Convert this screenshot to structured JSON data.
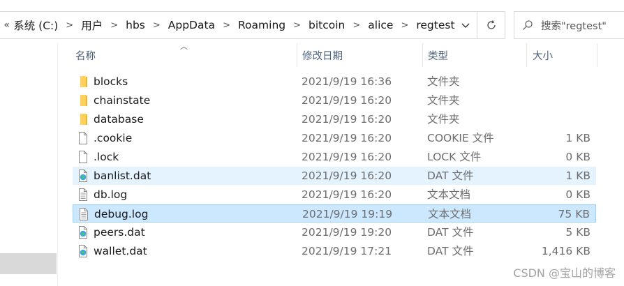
{
  "breadcrumb": {
    "overflow": "«",
    "items": [
      "系统 (C:)",
      "用户",
      "hbs",
      "AppData",
      "Roaming",
      "bitcoin",
      "alice",
      "regtest"
    ]
  },
  "search": {
    "placeholder": "搜索\"regtest\""
  },
  "columns": {
    "name": "名称",
    "date": "修改日期",
    "type": "类型",
    "size": "大小"
  },
  "files": [
    {
      "name": "blocks",
      "date": "2021/9/19 16:36",
      "type": "文件夹",
      "size": "",
      "icon": "folder-icon",
      "state": ""
    },
    {
      "name": "chainstate",
      "date": "2021/9/19 16:20",
      "type": "文件夹",
      "size": "",
      "icon": "folder-icon",
      "state": ""
    },
    {
      "name": "database",
      "date": "2021/9/19 16:20",
      "type": "文件夹",
      "size": "",
      "icon": "folder-icon",
      "state": ""
    },
    {
      "name": ".cookie",
      "date": "2021/9/19 16:20",
      "type": "COOKIE 文件",
      "size": "1 KB",
      "icon": "file-icon",
      "state": ""
    },
    {
      "name": ".lock",
      "date": "2021/9/19 16:20",
      "type": "LOCK 文件",
      "size": "0 KB",
      "icon": "file-icon",
      "state": ""
    },
    {
      "name": "banlist.dat",
      "date": "2021/9/19 16:20",
      "type": "DAT 文件",
      "size": "1 KB",
      "icon": "media-file-icon",
      "state": "hover"
    },
    {
      "name": "db.log",
      "date": "2021/9/19 16:20",
      "type": "文本文档",
      "size": "0 KB",
      "icon": "text-file-icon",
      "state": ""
    },
    {
      "name": "debug.log",
      "date": "2021/9/19 19:19",
      "type": "文本文档",
      "size": "75 KB",
      "icon": "text-file-icon",
      "state": "selected"
    },
    {
      "name": "peers.dat",
      "date": "2021/9/19 19:20",
      "type": "DAT 文件",
      "size": "5 KB",
      "icon": "media-file-icon",
      "state": ""
    },
    {
      "name": "wallet.dat",
      "date": "2021/9/19 17:21",
      "type": "DAT 文件",
      "size": "1,416 KB",
      "icon": "media-file-icon",
      "state": ""
    }
  ],
  "watermark": "CSDN @宝山的博客",
  "colors": {
    "selected_bg": "#cce8ff",
    "selected_border": "#99d1ff",
    "hover_bg": "#e5f3ff",
    "folder": "#ffd15c",
    "header_text": "#4c607a"
  }
}
